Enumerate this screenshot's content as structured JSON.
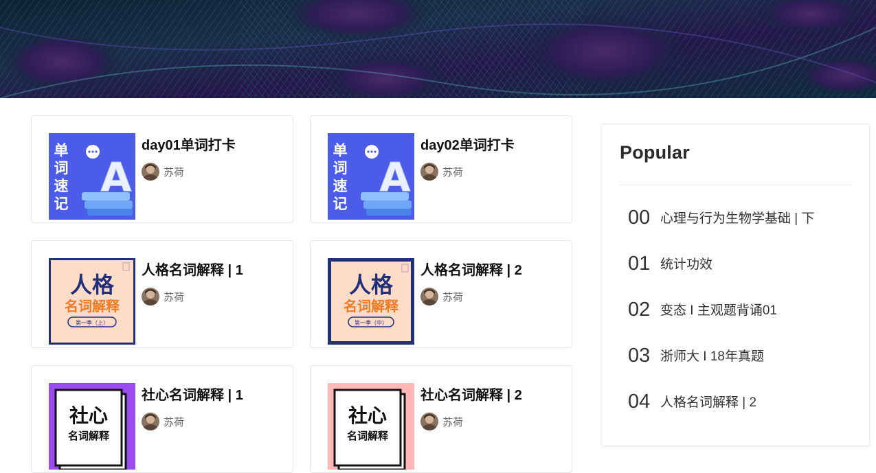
{
  "cards": [
    {
      "title": "day01单词打卡",
      "author": "苏荷",
      "cover": "word-memory"
    },
    {
      "title": "day02单词打卡",
      "author": "苏荷",
      "cover": "word-memory"
    },
    {
      "title": "人格名词解释 | 1",
      "author": "苏荷",
      "cover": "personality-terms"
    },
    {
      "title": "人格名词解释 | 2",
      "author": "苏荷",
      "cover": "personality-terms"
    },
    {
      "title": "社心名词解释 | 1",
      "author": "苏荷",
      "cover": "social-psych-terms"
    },
    {
      "title": "社心名词解释 | 2",
      "author": "苏荷",
      "cover": "social-psych-terms"
    }
  ],
  "covers": {
    "word": {
      "line1": "单",
      "line2": "词",
      "line3": "速",
      "line4": "记",
      "letter": "A"
    },
    "personality": {
      "big": "人格",
      "sub": "名词解释",
      "season_left": "第一季（上）",
      "season_right": "第一季（中）"
    },
    "social": {
      "big": "社心",
      "sub": "名词解释"
    }
  },
  "popular": {
    "title": "Popular",
    "items": [
      {
        "num": "00",
        "text": "心理与行为生物学基础 | 下"
      },
      {
        "num": "01",
        "text": "统计功效"
      },
      {
        "num": "02",
        "text": "变态 I 主观题背诵01"
      },
      {
        "num": "03",
        "text": "浙师大 I 18年真题"
      },
      {
        "num": "04",
        "text": "人格名词解释 | 2"
      }
    ]
  },
  "colors": {
    "word_cover_bg": "#4b5de8",
    "personality_cover_bg": "#ffdcc8",
    "personality_navy": "#22307a",
    "personality_orange": "#f27a21",
    "social_left_bg": "#9a4cf0",
    "social_right_bg": "#ffb8b6"
  }
}
